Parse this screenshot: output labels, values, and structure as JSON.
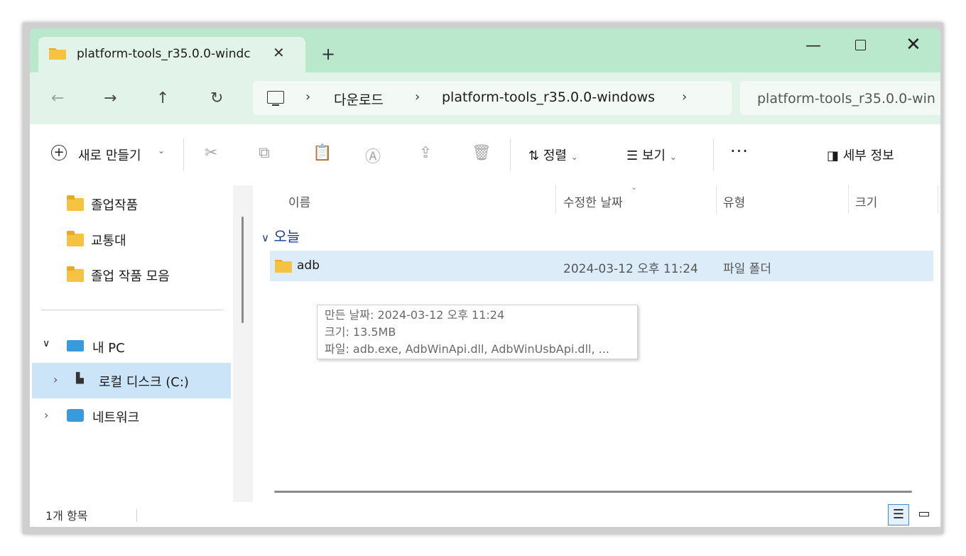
{
  "tab": {
    "title": "platform-tools_r35.0.0-windc"
  },
  "window_controls": {
    "minimize": "—",
    "close": "✕"
  },
  "nav": {
    "back": "←",
    "forward": "→",
    "up": "↑",
    "refresh": "↻"
  },
  "breadcrumb": [
    "다운로드",
    "platform-tools_r35.0.0-windows"
  ],
  "search": {
    "placeholder": "platform-tools_r35.0.0-win"
  },
  "toolbar": {
    "new_label": "새로 만들기",
    "sort_label": "정렬",
    "view_label": "보기",
    "more_label": "···",
    "details_label": "세부 정보"
  },
  "sidebar": {
    "folders": [
      "졸업작품",
      "교통대",
      "졸업 작품 모음"
    ],
    "this_pc": "내 PC",
    "local_disk": "로컬 디스크 (C:)",
    "network": "네트워크"
  },
  "columns": [
    "이름",
    "수정한 날짜",
    "유형",
    "크기"
  ],
  "group_label": "오늘",
  "files": [
    {
      "name": "adb",
      "modified": "2024-03-12 오후 11:24",
      "type": "파일 폴더",
      "size": ""
    }
  ],
  "tooltip": {
    "created": "만든 날짜: 2024-03-12 오후 11:24",
    "size": "크기: 13.5MB",
    "files": "파일: adb.exe, AdbWinApi.dll, AdbWinUsbApi.dll, ..."
  },
  "status": {
    "item_count": "1개 항목"
  },
  "colors": {
    "titlebar": "#b9e8cd",
    "addressbar": "#e2f4e9",
    "selection": "#dcecf9"
  }
}
